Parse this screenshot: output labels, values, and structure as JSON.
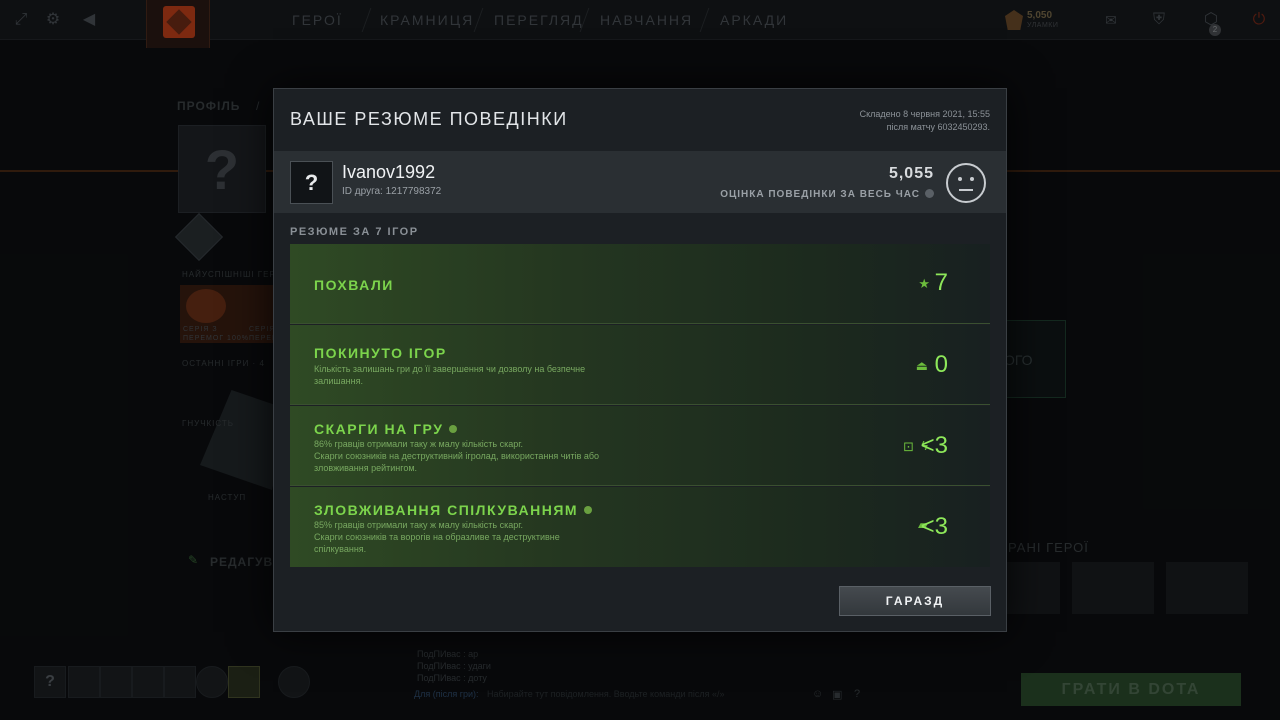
{
  "topbar": {
    "nav": [
      "ГЕРОЇ",
      "КРАМНИЦЯ",
      "ПЕРЕГЛЯД",
      "НАВЧАННЯ",
      "АРКАДИ"
    ],
    "shards_value": "5,050",
    "shards_label": "УЛАМКИ",
    "badge_count": "2"
  },
  "background": {
    "profile_label": "ПРОФІЛЬ",
    "profile_sep": "/",
    "avatar_placeholder": "?",
    "fastest_heroes": "НАЙУСПІШНІШІ ГЕРО",
    "streak_1a": "СЕРІЯ З",
    "streak_1b": "ПЕРЕМОГ 100%",
    "streak_2a": "СЕРІЯ",
    "streak_2b": "ПЕРЕМ",
    "last_games": "ОСТАННІ ІГРИ · 4",
    "flexibility": "ГНУЧКІСТЬ",
    "offense": "НАСТУП",
    "edit": "РЕДАГУВАТ",
    "right_box_text": "ОГО",
    "favorite_heroes": "РАНІ ГЕРОЇ",
    "chat_lines": [
      "ПодПИвас : ар",
      "ПодПИвас : удаги",
      "ПодПИвас : доту"
    ],
    "chat_prefix": "Для (після гри):",
    "chat_placeholder": "Набирайте тут повідомлення. Вводьте команди після «/»",
    "play_button": "ГРАТИ В DOTA",
    "help": "?"
  },
  "modal": {
    "title": "ВАШЕ РЕЗЮМЕ ПОВЕДІНКИ",
    "date_line1": "Складено 8 червня 2021, 15:55",
    "date_line2": "після матчу 6032450293.",
    "avatar": "?",
    "username": "Ivanov1992",
    "friend_id": "ID друга: 1217798372",
    "score": "5,055",
    "score_label": "ОЦІНКА ПОВЕДІНКИ ЗА ВЕСЬ ЧАС",
    "summary_label": "РЕЗЮМЕ ЗА 7 ІГОР",
    "cards": [
      {
        "title": "ПОХВАЛИ",
        "desc1": "",
        "desc2": "",
        "value": "7",
        "icon": "commend-star-icon"
      },
      {
        "title": "ПОКИНУТО ІГОР",
        "desc1": "Кількість залишань гри до її завершення чи дозволу на безпечне",
        "desc2": "залишання.",
        "value": "0",
        "icon": "exit-door-icon"
      },
      {
        "title": "СКАРГИ НА ГРУ",
        "desc1": "86% гравців отримали таку ж малу кількість скарг.",
        "desc2": "Скарги союзників на деструктивний ігролад, використання читів або",
        "desc3": "зловживання рейтингом.",
        "value": "<3",
        "icon": "lock-lightning-icon"
      },
      {
        "title": "ЗЛОВЖИВАННЯ СПІЛКУВАННЯМ",
        "desc1": "85% гравців отримали таку ж малу кількість скарг.",
        "desc2": "Скарги союзників та ворогів на образливе та деструктивне",
        "desc3": "спілкування.",
        "value": "<3",
        "icon": "chat-bubble-icon"
      }
    ],
    "ok_button": "ГАРАЗД"
  }
}
